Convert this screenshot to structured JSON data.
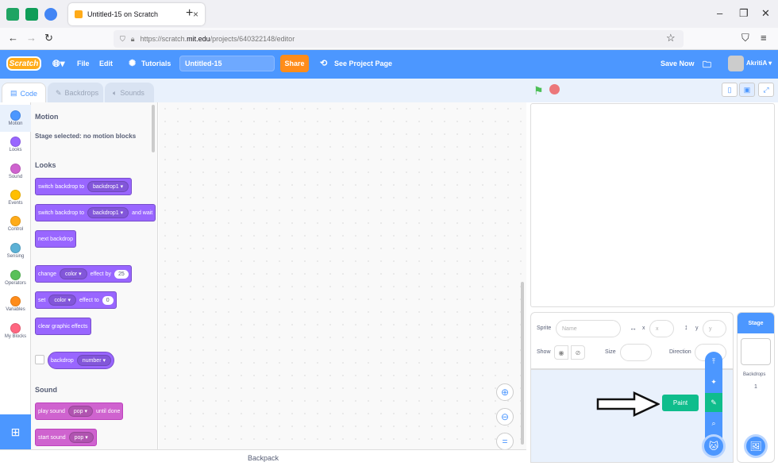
{
  "browser": {
    "tab_title": "Untitled-15 on Scratch",
    "url_prefix": "https://scratch.",
    "url_domain": "mit.edu",
    "url_suffix": "/projects/640322148/editor"
  },
  "menubar": {
    "logo": "Scratch",
    "file": "File",
    "edit": "Edit",
    "tutorials": "Tutorials",
    "project_title": "Untitled-15",
    "share": "Share",
    "see_project_page": "See Project Page",
    "save_now": "Save Now",
    "username": "AkritiA"
  },
  "editor_tabs": {
    "code": "Code",
    "backdrops": "Backdrops",
    "sounds": "Sounds"
  },
  "categories": [
    {
      "label": "Motion",
      "color": "#4c97ff"
    },
    {
      "label": "Looks",
      "color": "#9966ff"
    },
    {
      "label": "Sound",
      "color": "#cf63cf"
    },
    {
      "label": "Events",
      "color": "#ffbf00"
    },
    {
      "label": "Control",
      "color": "#ffab19"
    },
    {
      "label": "Sensing",
      "color": "#5cb1d6"
    },
    {
      "label": "Operators",
      "color": "#59c059"
    },
    {
      "label": "Variables",
      "color": "#ff8c1a"
    },
    {
      "label": "My Blocks",
      "color": "#ff6680"
    }
  ],
  "palette": {
    "motion_heading": "Motion",
    "motion_note": "Stage selected: no motion blocks",
    "looks_heading": "Looks",
    "sound_heading": "Sound",
    "blocks": {
      "b1_text": "switch backdrop to",
      "b1_dd": "backdrop1",
      "b2_text": "switch backdrop to",
      "b2_dd": "backdrop1",
      "b2_tail": "and wait",
      "b3_text": "next backdrop",
      "b4_text": "change",
      "b4_dd": "color",
      "b4_mid": "effect by",
      "b4_num": "25",
      "b5_text": "set",
      "b5_dd": "color",
      "b5_mid": "effect to",
      "b5_num": "0",
      "b6_text": "clear graphic effects",
      "r1_text": "backdrop",
      "r1_dd": "number",
      "s1_text": "play sound",
      "s1_dd": "pop",
      "s1_tail": "until done",
      "s2_text": "start sound",
      "s2_dd": "pop"
    }
  },
  "backpack": "Backpack",
  "sprite_info": {
    "sprite_label": "Sprite",
    "name_placeholder": "Name",
    "x_label": "x",
    "x_placeholder": "x",
    "y_label": "y",
    "y_placeholder": "y",
    "show_label": "Show",
    "size_label": "Size",
    "direction_label": "Direction"
  },
  "stage_pane": {
    "header": "Stage",
    "backdrops_label": "Backdrops",
    "backdrops_count": "1"
  },
  "paint_tooltip": "Paint"
}
